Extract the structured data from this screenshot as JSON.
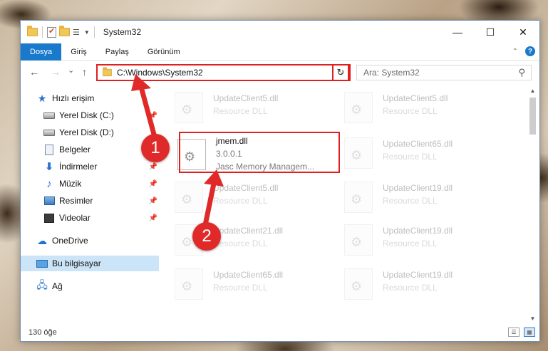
{
  "window": {
    "title": "System32",
    "controls": {
      "minimize": "—",
      "maximize": "☐",
      "close": "✕"
    }
  },
  "ribbon": {
    "tabs": [
      "Dosya",
      "Giriş",
      "Paylaş",
      "Görünüm"
    ],
    "help": "?"
  },
  "nav": {
    "back": "←",
    "forward": "→",
    "recent": "⌄",
    "up": "↑",
    "address": "C:\\Windows\\System32",
    "refresh": "↻",
    "search_placeholder": "Ara: System32"
  },
  "sidebar": {
    "items": [
      {
        "label": "Hızlı erişim",
        "icon": "star-icon"
      },
      {
        "label": "Yerel Disk (C:)",
        "icon": "drive-icon",
        "pinned": true
      },
      {
        "label": "Yerel Disk (D:)",
        "icon": "drive-icon"
      },
      {
        "label": "Belgeler",
        "icon": "document-icon",
        "pinned": true
      },
      {
        "label": "İndirmeler",
        "icon": "download-icon",
        "pinned": true
      },
      {
        "label": "Müzik",
        "icon": "music-icon",
        "pinned": true
      },
      {
        "label": "Resimler",
        "icon": "pictures-icon",
        "pinned": true
      },
      {
        "label": "Videolar",
        "icon": "video-icon",
        "pinned": true
      },
      {
        "label": "OneDrive",
        "icon": "cloud-icon"
      },
      {
        "label": "Bu bilgisayar",
        "icon": "computer-icon",
        "selected": true
      },
      {
        "label": "Ağ",
        "icon": "network-icon"
      }
    ]
  },
  "files": {
    "col1": [
      {
        "name": "UpdateClient5.dll",
        "desc": "Resource DLL"
      },
      {
        "name": "jmem.dll",
        "version": "3.0.0.1",
        "desc": "Jasc Memory Managem...",
        "focused": true
      },
      {
        "name": "UpdateClient5.dll",
        "desc": "Resource DLL"
      },
      {
        "name": "UpdateClient21.dll",
        "desc": "Resource DLL"
      },
      {
        "name": "UpdateClient65.dll",
        "desc": "Resource DLL"
      }
    ],
    "col2": [
      {
        "name": "UpdateClient5.dll",
        "desc": "Resource DLL"
      },
      {
        "name": "UpdateClient65.dll",
        "desc": "Resource DLL"
      },
      {
        "name": "UpdateClient19.dll",
        "desc": "Resource DLL"
      },
      {
        "name": "UpdateClient19.dll",
        "desc": "Resource DLL"
      },
      {
        "name": "UpdateClient19.dll",
        "desc": "Resource DLL"
      }
    ]
  },
  "status": {
    "count": "130 öğe"
  },
  "annotations": {
    "badge1": "1",
    "badge2": "2",
    "highlight_color": "#e02020"
  }
}
